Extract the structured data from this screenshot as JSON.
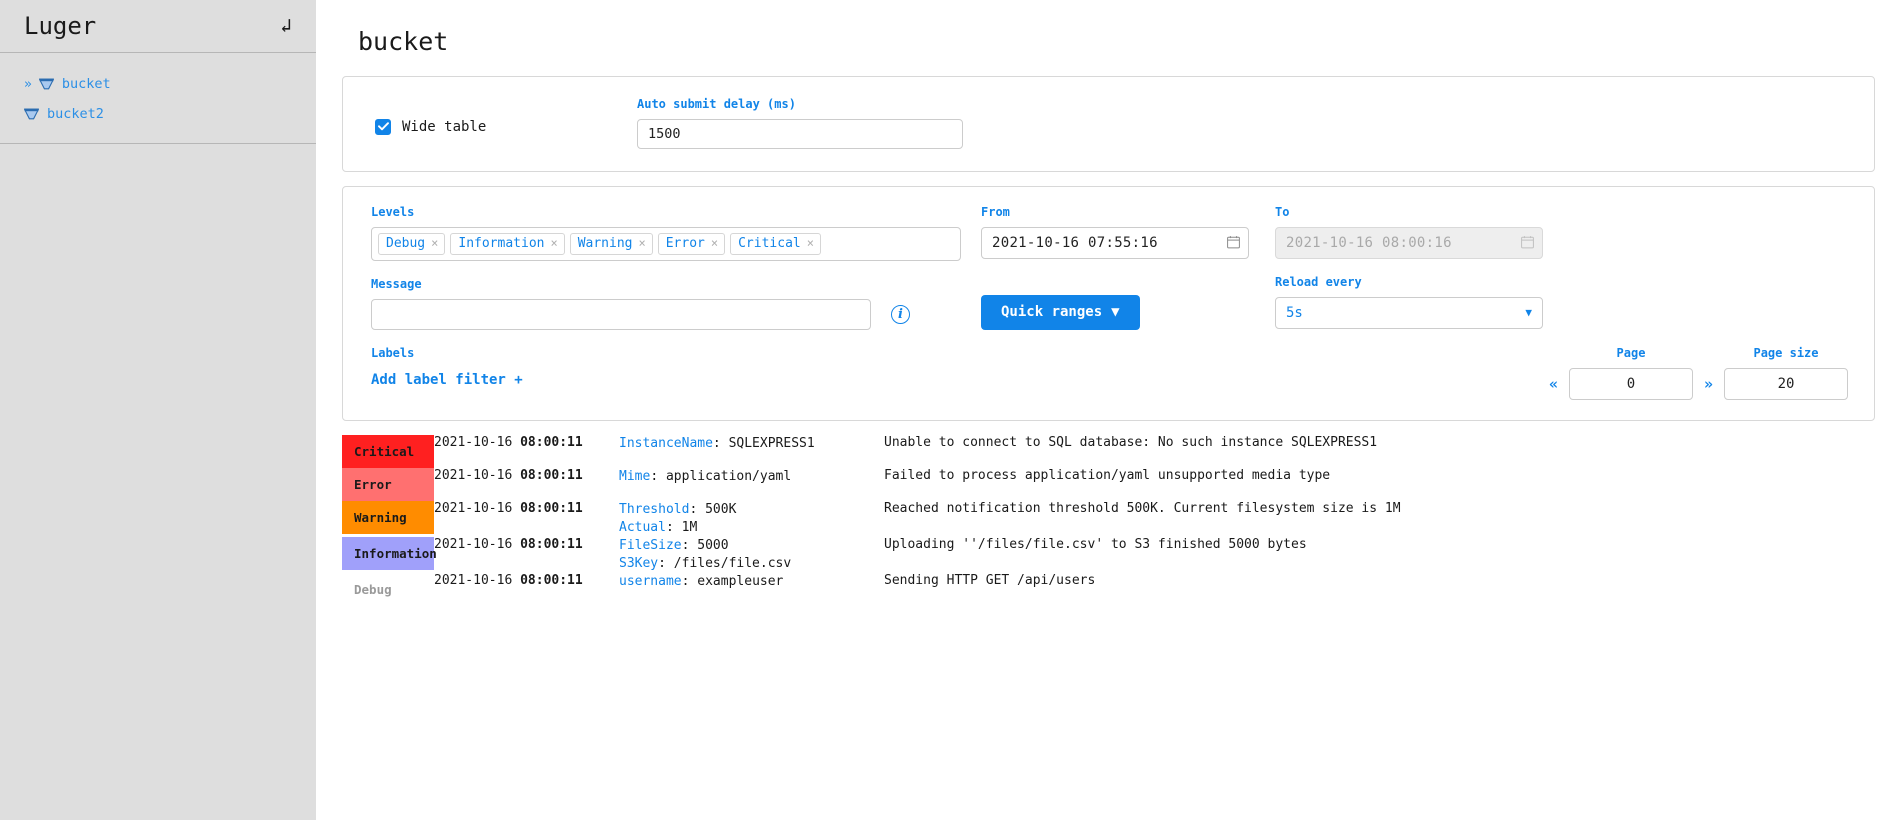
{
  "sidebar": {
    "title": "Luger",
    "refresh_icon": "refresh-icon",
    "items": [
      {
        "label": "bucket",
        "icon": "bucket-icon",
        "chevron": "»",
        "expanded": true
      },
      {
        "label": "bucket2",
        "icon": "bucket-icon",
        "chevron": "",
        "expanded": false
      }
    ]
  },
  "page": {
    "title": "bucket"
  },
  "options": {
    "wide_table_label": "Wide table",
    "wide_table_checked": true,
    "auto_submit_label": "Auto submit delay (ms)",
    "auto_submit_value": "1500"
  },
  "filters": {
    "levels_label": "Levels",
    "levels": [
      {
        "label": "Debug",
        "remove": "×"
      },
      {
        "label": "Information",
        "remove": "×"
      },
      {
        "label": "Warning",
        "remove": "×"
      },
      {
        "label": "Error",
        "remove": "×"
      },
      {
        "label": "Critical",
        "remove": "×"
      }
    ],
    "message_label": "Message",
    "message_value": "",
    "message_placeholder": "",
    "info_icon": "info-icon",
    "labels_label": "Labels",
    "add_label_filter": "Add label filter +",
    "from_label": "From",
    "from_value": "2021-10-16 07:55:16",
    "to_label": "To",
    "to_value": "2021-10-16 08:00:16",
    "to_disabled": true,
    "quick_ranges_label": "Quick ranges",
    "quick_ranges_caret": "▼",
    "reload_label": "Reload every",
    "reload_value": "5s",
    "reload_caret": "▼",
    "page_label": "Page",
    "page_value": "0",
    "page_size_label": "Page size",
    "page_size_value": "20",
    "prev_page": "«",
    "next_page": "»"
  },
  "colors": {
    "accent": "#1184e8",
    "sidebar_bg": "#dedede",
    "critical": "#ff2020",
    "error": "#ff7070",
    "warning": "#ff8c00",
    "information": "#a0a0fa",
    "debug": "#ffffff",
    "debug_text": "#9a9a9a"
  },
  "logs": [
    {
      "level": "Critical",
      "level_color": "#ff2020",
      "level_text_color": "#1a1a1a",
      "date": "2021-10-16 ",
      "time": "08:00:11",
      "props": [
        {
          "key": "InstanceName",
          "value": ": SQLEXPRESS1"
        }
      ],
      "message": "Unable to connect to SQL database: No such instance SQLEXPRESS1"
    },
    {
      "level": "Error",
      "level_color": "#ff7070",
      "level_text_color": "#1a1a1a",
      "date": "2021-10-16 ",
      "time": "08:00:11",
      "props": [
        {
          "key": "Mime",
          "value": ": application/yaml"
        }
      ],
      "message": "Failed to process application/yaml unsupported media type"
    },
    {
      "level": "Warning",
      "level_color": "#ff8c00",
      "level_text_color": "#1a1a1a",
      "date": "2021-10-16 ",
      "time": "08:00:11",
      "props": [
        {
          "key": "Threshold",
          "value": ": 500K"
        },
        {
          "key": "Actual",
          "value": ": 1M"
        }
      ],
      "message": "Reached notification threshold 500K. Current filesystem size is 1M"
    },
    {
      "level": "Information",
      "level_color": "#a0a0fa",
      "level_text_color": "#1a1a1a",
      "date": "2021-10-16 ",
      "time": "08:00:11",
      "props": [
        {
          "key": "FileSize",
          "value": ": 5000"
        },
        {
          "key": "S3Key",
          "value": ": /files/file.csv"
        }
      ],
      "message": "Uploading ''/files/file.csv' to S3 finished 5000 bytes"
    },
    {
      "level": "Debug",
      "level_color": "#ffffff",
      "level_text_color": "#9a9a9a",
      "date": "2021-10-16 ",
      "time": "08:00:11",
      "props": [
        {
          "key": "username",
          "value": ": exampleuser"
        }
      ],
      "message": "Sending HTTP GET /api/users"
    }
  ]
}
